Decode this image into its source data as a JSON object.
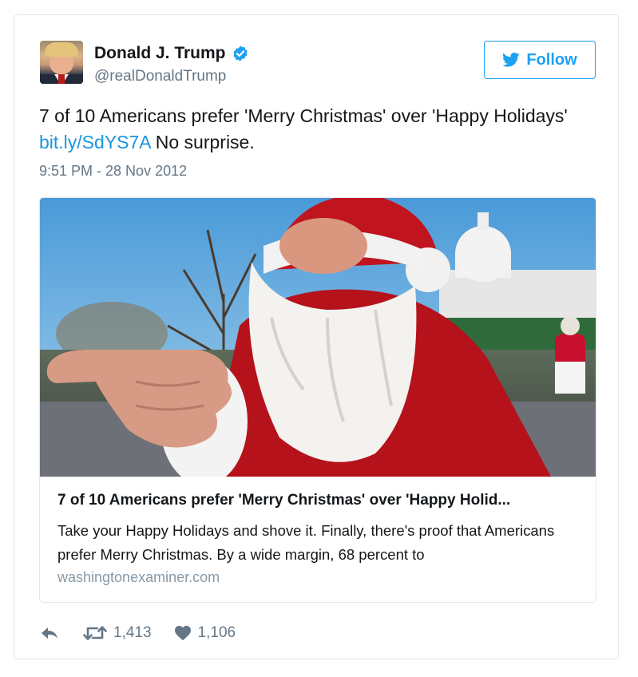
{
  "author": {
    "name": "Donald J. Trump",
    "handle": "@realDonaldTrump",
    "verified_icon": "verified-badge-icon"
  },
  "follow_button": {
    "label": "Follow",
    "icon": "twitter-bird-icon"
  },
  "tweet": {
    "text_before_link": "7 of 10 Americans prefer 'Merry Christmas' over 'Happy Holidays' ",
    "link_text": "bit.ly/SdYS7A",
    "text_after_link": " No surprise.",
    "timestamp": "9:51 PM - 28 Nov 2012"
  },
  "card": {
    "title": "7 of 10 Americans prefer 'Merry Christmas' over 'Happy Holid...",
    "description": "Take your Happy Holidays and shove it. Finally, there's proof that Americans prefer Merry Christmas. By a wide margin, 68 percent to",
    "domain": "washingtonexaminer.com"
  },
  "actions": {
    "reply_icon": "reply-icon",
    "retweet_icon": "retweet-icon",
    "retweet_count": "1,413",
    "like_icon": "heart-icon",
    "like_count": "1,106"
  },
  "colors": {
    "accent": "#1da1f2",
    "link": "#1b95e0",
    "secondary_text": "#657786",
    "border": "#e1e8ed"
  }
}
